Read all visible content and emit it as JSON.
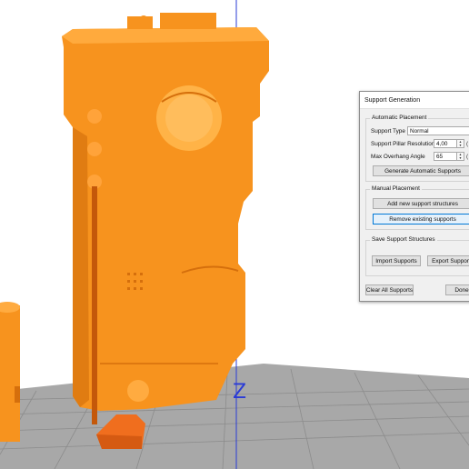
{
  "axis": {
    "z_label": "Z"
  },
  "dialog": {
    "title": "Support Generation",
    "automatic": {
      "title": "Automatic Placement",
      "support_type_label": "Support Type",
      "support_type_value": "Normal",
      "pillar_resolution_label": "Support Pillar Resolution",
      "pillar_resolution_value": "4,00",
      "pillar_resolution_suffix": "(",
      "overhang_label": "Max Overhang Angle",
      "overhang_value": "65",
      "overhang_suffix": "(",
      "generate_button": "Generate Automatic Supports"
    },
    "manual": {
      "title": "Manual Placement",
      "add_button": "Add new support structures",
      "remove_button": "Remove existing supports"
    },
    "save": {
      "title": "Save Support Structures",
      "import_button": "Import Supports",
      "export_button": "Export Supports"
    },
    "clear_button": "Clear All Supports",
    "done_button": "Done"
  },
  "colors": {
    "model": "#f7931e",
    "model_shadow": "#d56f0c",
    "floor": "#a9a9a9",
    "grid": "#8a8a8a",
    "axis": "#2a3bd6",
    "background": "#ffffff"
  }
}
